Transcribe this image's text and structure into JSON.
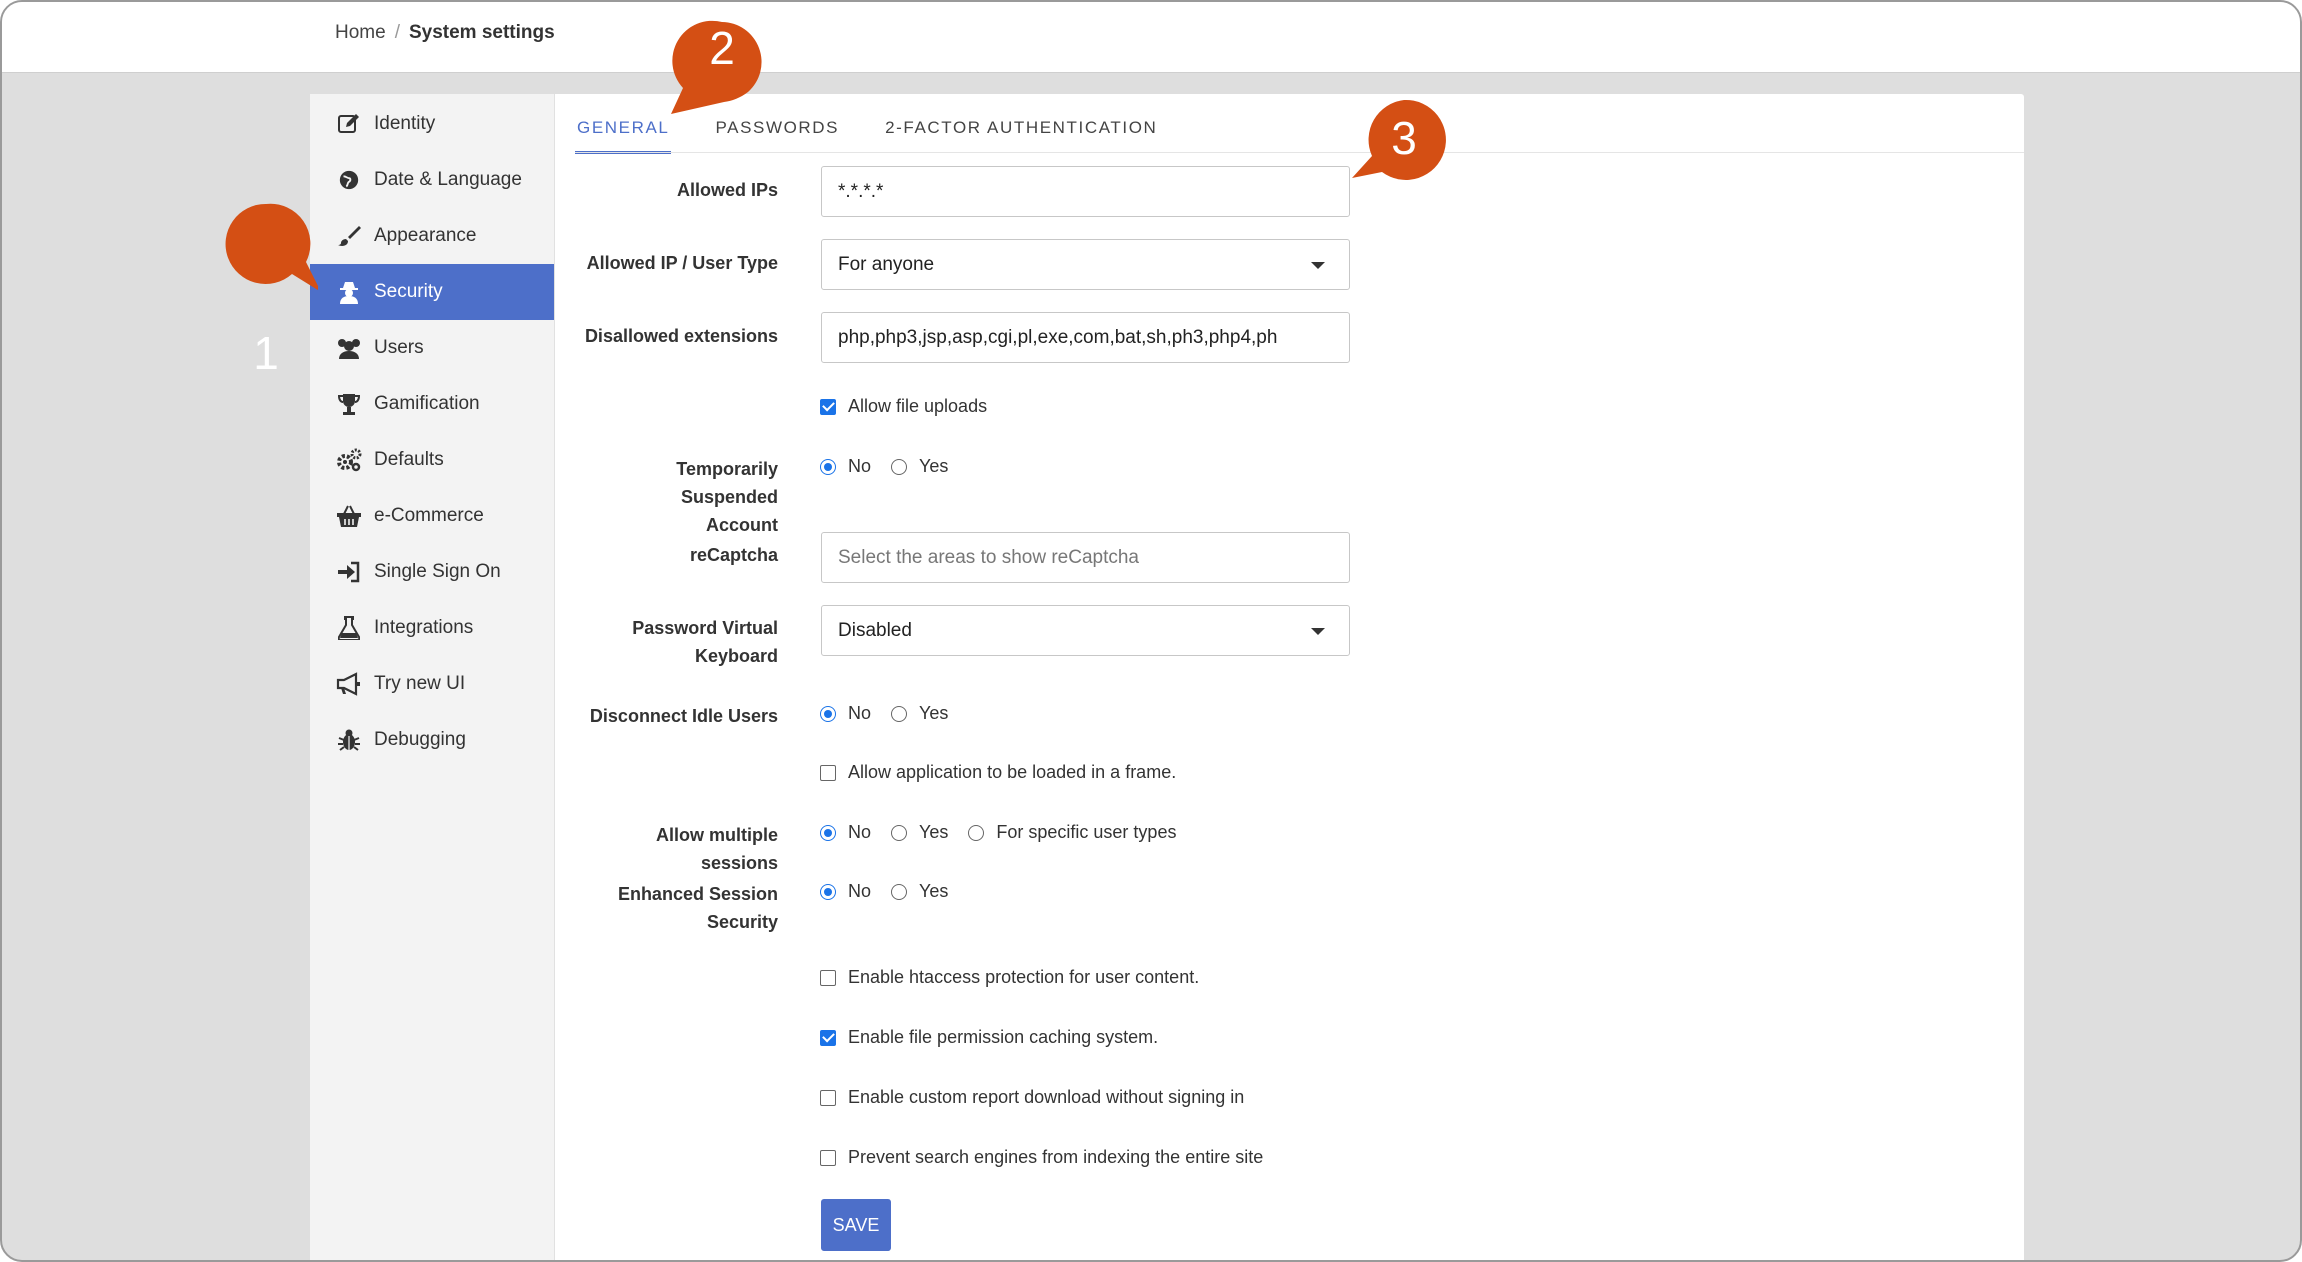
{
  "breadcrumb": {
    "home": "Home",
    "separator": "/",
    "current": "System settings"
  },
  "sidebar": {
    "items": [
      {
        "label": "Identity",
        "icon": "edit-icon"
      },
      {
        "label": "Date & Language",
        "icon": "globe-icon"
      },
      {
        "label": "Appearance",
        "icon": "paintbrush-icon"
      },
      {
        "label": "Security",
        "icon": "user-secret-icon",
        "active": true
      },
      {
        "label": "Users",
        "icon": "users-icon"
      },
      {
        "label": "Gamification",
        "icon": "trophy-icon"
      },
      {
        "label": "Defaults",
        "icon": "gears-icon"
      },
      {
        "label": "e-Commerce",
        "icon": "basket-icon"
      },
      {
        "label": "Single Sign On",
        "icon": "sign-in-icon"
      },
      {
        "label": "Integrations",
        "icon": "flask-icon"
      },
      {
        "label": "Try new UI",
        "icon": "megaphone-icon"
      },
      {
        "label": "Debugging",
        "icon": "bug-icon"
      }
    ]
  },
  "tabs": [
    {
      "label": "GENERAL",
      "active": true
    },
    {
      "label": "PASSWORDS"
    },
    {
      "label": "2-FACTOR AUTHENTICATION"
    }
  ],
  "form": {
    "allowed_ips": {
      "label": "Allowed IPs",
      "value": "*.*.*.*"
    },
    "allowed_ip_user_type": {
      "label": "Allowed IP / User Type",
      "value": "For anyone"
    },
    "disallowed_extensions": {
      "label": "Disallowed extensions",
      "value": "php,php3,jsp,asp,cgi,pl,exe,com,bat,sh,ph3,php4,ph"
    },
    "allow_file_uploads": {
      "label": "Allow file uploads",
      "checked": true
    },
    "temporarily_suspended": {
      "label_line1": "Temporarily Suspended",
      "label_line2": "Account",
      "options": [
        "No",
        "Yes"
      ],
      "selected": "No"
    },
    "recaptcha": {
      "label": "reCaptcha",
      "placeholder": "Select the areas to show reCaptcha"
    },
    "password_virtual_keyboard": {
      "label_line1": "Password Virtual",
      "label_line2": "Keyboard",
      "value": "Disabled"
    },
    "disconnect_idle_users": {
      "label": "Disconnect Idle Users",
      "options": [
        "No",
        "Yes"
      ],
      "selected": "No"
    },
    "allow_frame": {
      "label": "Allow application to be loaded in a frame.",
      "checked": false
    },
    "allow_multiple_sessions": {
      "label": "Allow multiple sessions",
      "options": [
        "No",
        "Yes",
        "For specific user types"
      ],
      "selected": "No"
    },
    "enhanced_session_security": {
      "label_line1": "Enhanced Session",
      "label_line2": "Security",
      "options": [
        "No",
        "Yes"
      ],
      "selected": "No"
    },
    "htaccess_protection": {
      "label": "Enable htaccess protection for user content.",
      "checked": false
    },
    "file_permission_caching": {
      "label": "Enable file permission caching system.",
      "checked": true
    },
    "custom_report_download": {
      "label": "Enable custom report download without signing in",
      "checked": false
    },
    "prevent_search_indexing": {
      "label": "Prevent search engines from indexing the entire site",
      "checked": false
    },
    "save_label": "SAVE"
  },
  "callouts": [
    {
      "number": "1"
    },
    {
      "number": "2"
    },
    {
      "number": "3"
    }
  ],
  "colors": {
    "accent": "#4d6fc9",
    "callout": "#d44f14",
    "checkbox": "#1a73e8"
  }
}
